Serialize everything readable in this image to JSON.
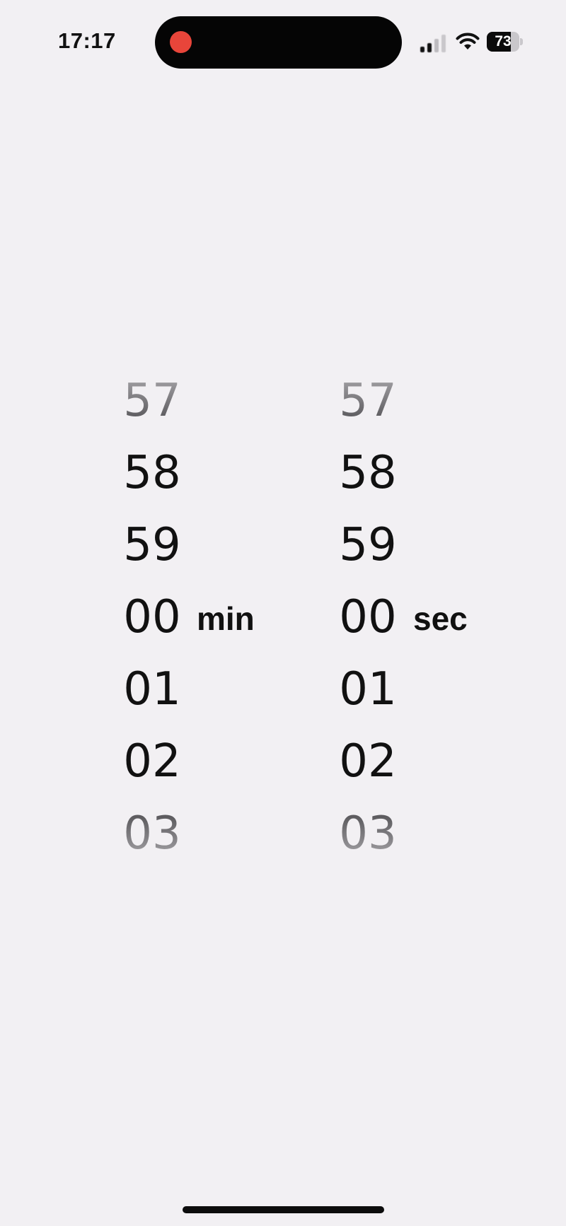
{
  "status_bar": {
    "time": "17:17",
    "battery_level": "73",
    "battery_fraction": 0.73,
    "recording": true,
    "record_color": "#e8453a",
    "icons": [
      "signal-icon",
      "wifi-icon",
      "battery-icon"
    ]
  },
  "picker": {
    "minutes": {
      "items": [
        "57",
        "58",
        "59",
        "00",
        "01",
        "02",
        "03"
      ],
      "selected": "00",
      "unit": "min"
    },
    "seconds": {
      "items": [
        "57",
        "58",
        "59",
        "00",
        "01",
        "02",
        "03"
      ],
      "selected": "00",
      "unit": "sec"
    }
  },
  "colors": {
    "background": "#f2f0f3",
    "text": "#111111"
  }
}
